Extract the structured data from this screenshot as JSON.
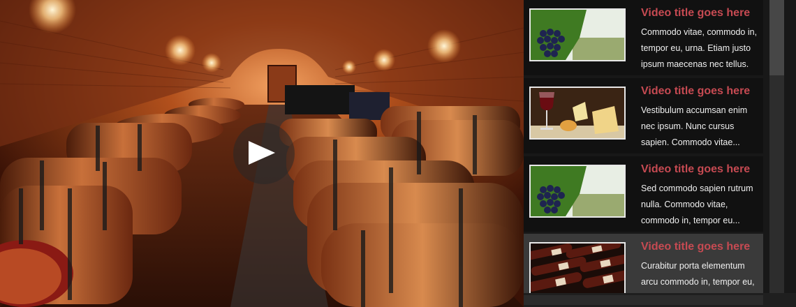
{
  "player": {
    "play_button": "play-icon",
    "scene": "wine-cellar-video-frame"
  },
  "playlist": {
    "items": [
      {
        "title": "Video title goes here",
        "description": "Commodo vitae, commodo in, tempor eu, urna. Etiam justo ipsum maecenas nec tellus.",
        "thumbnail": "grapes-thumbnail",
        "active": false
      },
      {
        "title": "Video title goes here",
        "description": "Vestibulum accumsan enim nec ipsum. Nunc cursus sapien. Commodo vitae...",
        "thumbnail": "wine-and-cheese-thumbnail",
        "active": false
      },
      {
        "title": "Video title goes here",
        "description": "Sed commodo sapien rutrum nulla. Commodo vitae, commodo in, tempor eu...",
        "thumbnail": "grapes-thumbnail",
        "active": false
      },
      {
        "title": "Video title goes here",
        "description": "Curabitur porta elementum arcu commodo in, tempor eu, urna. Etiam justo ipsum",
        "thumbnail": "wine-bottles-thumbnail",
        "active": true
      }
    ]
  },
  "colors": {
    "title_accent": "#c64a52",
    "panel_bg": "#111111",
    "active_bg": "#3a3a3a"
  }
}
